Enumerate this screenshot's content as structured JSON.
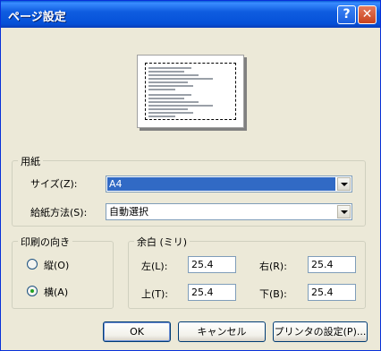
{
  "window": {
    "title": "ページ設定",
    "help_button": "?",
    "close_button": "✕"
  },
  "paper": {
    "group_label": "用紙",
    "size_label": "サイズ(Z):",
    "size_value": "A4",
    "source_label": "給紙方法(S):",
    "source_value": "自動選択"
  },
  "orientation": {
    "group_label": "印刷の向き",
    "portrait_label": "縦(O)",
    "landscape_label": "横(A)",
    "selected": "landscape"
  },
  "margins": {
    "group_label": "余白 (ミリ)",
    "left_label": "左(L):",
    "left_value": "25.4",
    "right_label": "右(R):",
    "right_value": "25.4",
    "top_label": "上(T):",
    "top_value": "25.4",
    "bottom_label": "下(B):",
    "bottom_value": "25.4"
  },
  "buttons": {
    "ok": "OK",
    "cancel": "キャンセル",
    "printer": "プリンタの設定(P)..."
  },
  "colors": {
    "accent": "#316ac5",
    "dialog_bg": "#ece9d8",
    "titlebar": "#0550d8"
  }
}
